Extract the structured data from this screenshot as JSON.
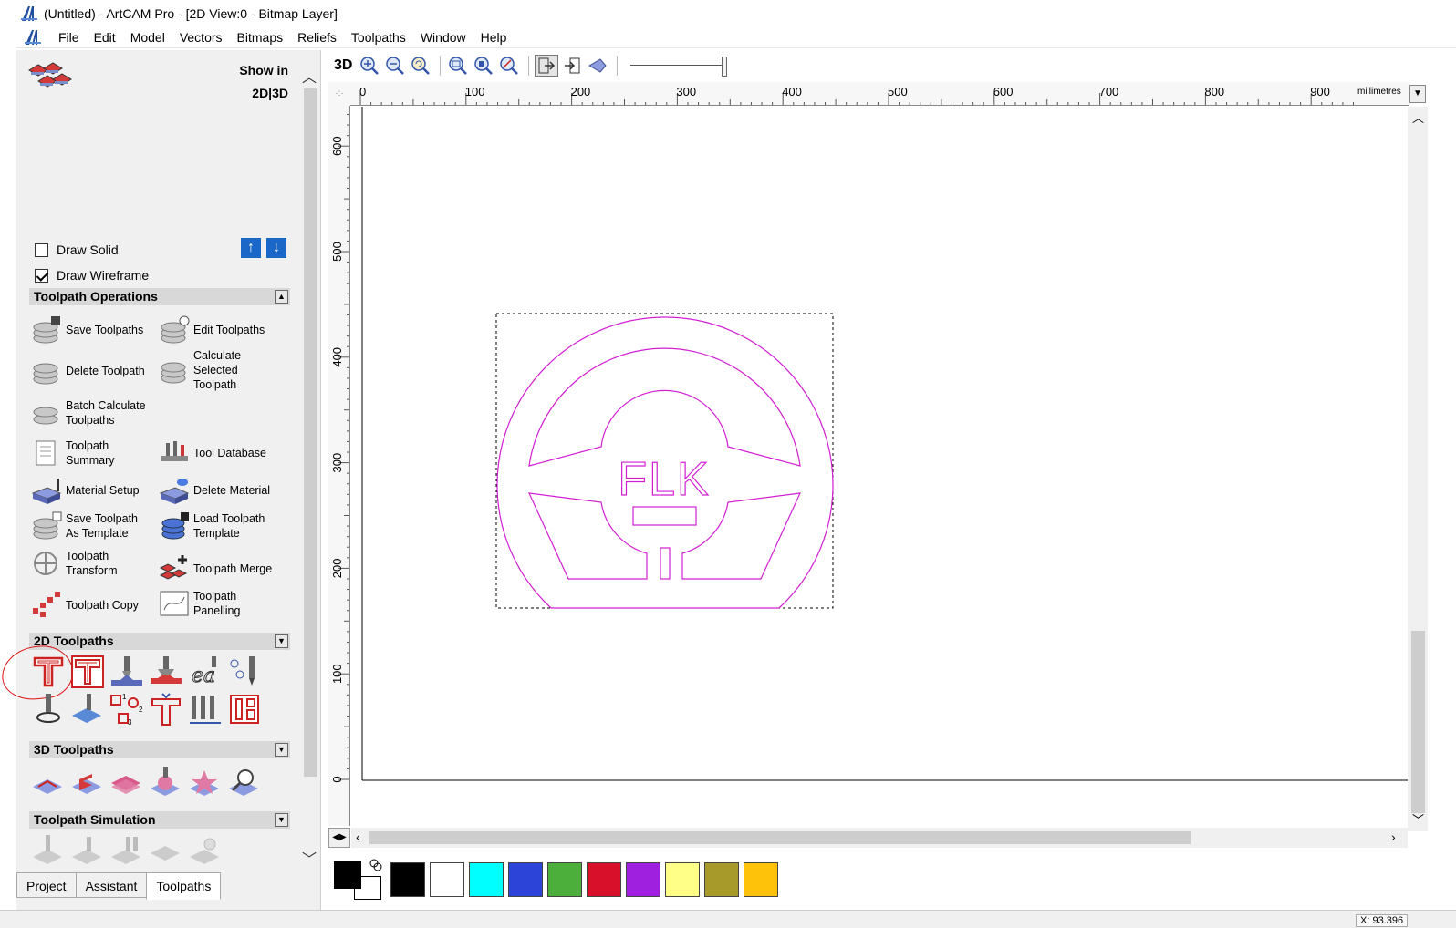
{
  "window": {
    "title": "(Untitled) - ArtCAM Pro - [2D View:0 - Bitmap Layer]",
    "app_icon": "artcam-logo-icon"
  },
  "menu": [
    "File",
    "Edit",
    "Model",
    "Vectors",
    "Bitmaps",
    "Reliefs",
    "Toolpaths",
    "Window",
    "Help"
  ],
  "panel": {
    "show_in_line1": "Show in",
    "show_in_line2": "2D|3D",
    "draw_solid": "Draw Solid",
    "draw_wireframe": "Draw Wireframe",
    "draw_solid_checked": false,
    "draw_wireframe_checked": true,
    "up_arrow": "↑",
    "down_arrow": "↓",
    "sections": {
      "ops": "Toolpath Operations",
      "toolpaths2d": "2D Toolpaths",
      "toolpaths3d": "3D Toolpaths",
      "simulation": "Toolpath Simulation"
    },
    "ops": {
      "save_toolpaths": "Save Toolpaths",
      "edit_toolpaths": "Edit Toolpaths",
      "delete_toolpath": "Delete Toolpath",
      "calc_selected_1": "Calculate",
      "calc_selected_2": "Selected",
      "calc_selected_3": "Toolpath",
      "batch_1": "Batch Calculate",
      "batch_2": "Toolpaths",
      "summary_1": "Toolpath",
      "summary_2": "Summary",
      "tool_database": "Tool Database",
      "material_setup": "Material Setup",
      "delete_material": "Delete Material",
      "save_template_1": "Save Toolpath",
      "save_template_2": "As Template",
      "load_template_1": "Load Toolpath",
      "load_template_2": "Template",
      "transform_1": "Toolpath",
      "transform_2": "Transform",
      "merge": "Toolpath Merge",
      "copy": "Toolpath Copy",
      "panelling_1": "Toolpath",
      "panelling_2": "Panelling"
    },
    "tabs": [
      "Project",
      "Assistant",
      "Toolpaths"
    ],
    "active_tab": "Toolpaths"
  },
  "view": {
    "label_3d": "3D",
    "units": "millimetres",
    "ruler_x": [
      "0",
      "100",
      "200",
      "300",
      "400",
      "500",
      "600",
      "700",
      "800",
      "900"
    ],
    "ruler_y": [
      "600",
      "500",
      "400",
      "300",
      "200",
      "100",
      "0"
    ],
    "drawing_text": "FLK",
    "coord_readout": "X: 93.396"
  },
  "colors": {
    "vector": "#d21ed2",
    "palette": [
      "#000000",
      "#ffffff",
      "#00ffff",
      "#2c44d8",
      "#4caf3c",
      "#d8102a",
      "#a020e0",
      "#ffff88",
      "#a89a2a",
      "#ffc20a"
    ]
  }
}
